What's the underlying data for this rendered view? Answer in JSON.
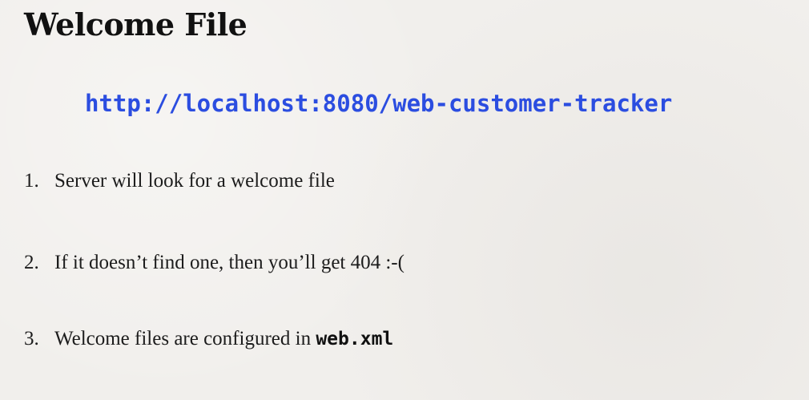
{
  "slide": {
    "title": "Welcome File",
    "url": "http://localhost:8080/web-customer-tracker",
    "points": [
      {
        "number": "1.",
        "text": "Server will look for a welcome file"
      },
      {
        "number": "2.",
        "text": "If it doesn’t find one, then you’ll get 404 :-("
      },
      {
        "number": "3.",
        "text": "Welcome files are configured in ",
        "code": "web.xml"
      }
    ],
    "colors": {
      "background": "#f1efec",
      "url": "#2b4de0",
      "text": "#1c1c1c"
    }
  }
}
